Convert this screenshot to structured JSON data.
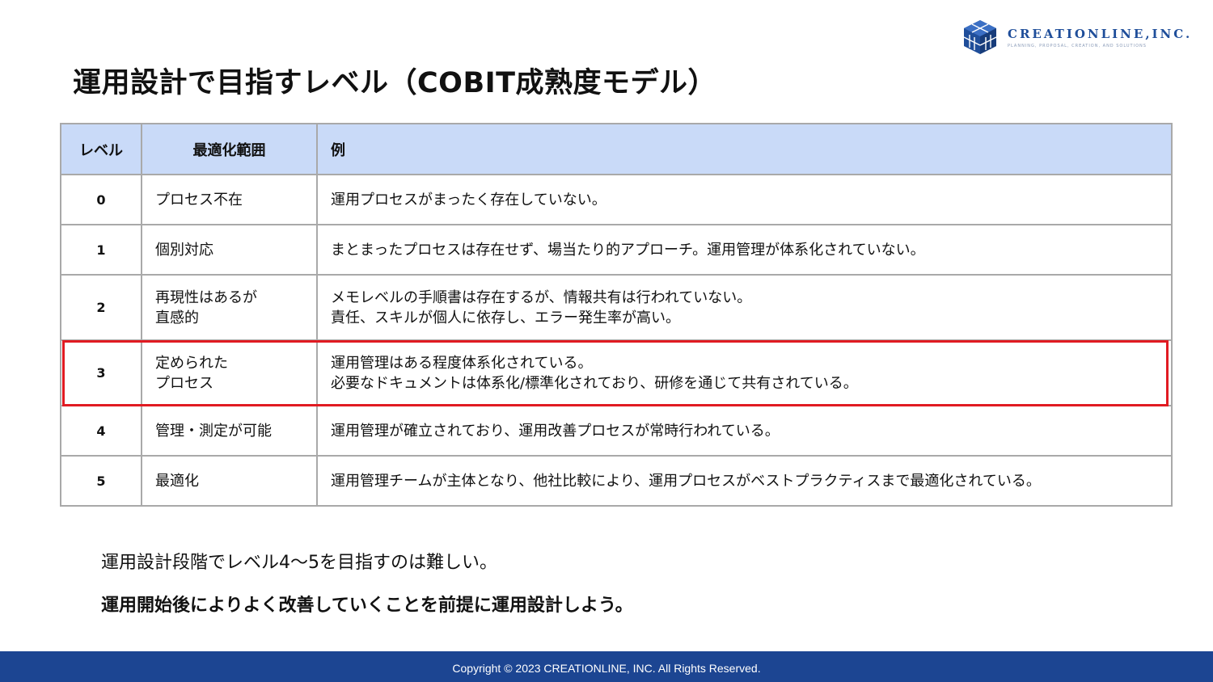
{
  "logo": {
    "name": "CREATIONLINE,INC.",
    "tagline": "PLANNING, PROPOSAL, CREATION, AND SOLUTIONS",
    "brand_color": "#1f4e9a"
  },
  "title": "運用設計で目指すレベル（COBIT成熟度モデル）",
  "table": {
    "headers": [
      "レベル",
      "最適化範囲",
      "例"
    ],
    "header_bg": "#c9daf8",
    "rows": [
      {
        "level": "0",
        "scope": "プロセス不在",
        "example": "運用プロセスがまったく存在していない。"
      },
      {
        "level": "1",
        "scope": "個別対応",
        "example": "まとまったプロセスは存在せず、場当たり的アプローチ。運用管理が体系化されていない。"
      },
      {
        "level": "2",
        "scope": "再現性はあるが\n直感的",
        "example": "メモレベルの手順書は存在するが、情報共有は行われていない。\n責任、スキルが個人に依存し、エラー発生率が高い。"
      },
      {
        "level": "3",
        "scope": "定められた\nプロセス",
        "example": "運用管理はある程度体系化されている。\n必要なドキュメントは体系化/標準化されており、研修を通じて共有されている。"
      },
      {
        "level": "4",
        "scope": "管理・測定が可能",
        "example": "運用管理が確立されており、運用改善プロセスが常時行われている。"
      },
      {
        "level": "5",
        "scope": "最適化",
        "example": "運用管理チームが主体となり、他社比較により、運用プロセスがベストプラクティスまで最適化されている。"
      }
    ],
    "highlight_color": "#e11b22"
  },
  "notes": [
    "運用設計段階でレベル4〜5を目指すのは難しい。",
    "運用開始後によりよく改善していくことを前提に運用設計しよう。"
  ],
  "footer": {
    "copyright": "Copyright © 2023 CREATIONLINE, INC. All Rights Reserved.",
    "bg_color": "#1c4592"
  }
}
